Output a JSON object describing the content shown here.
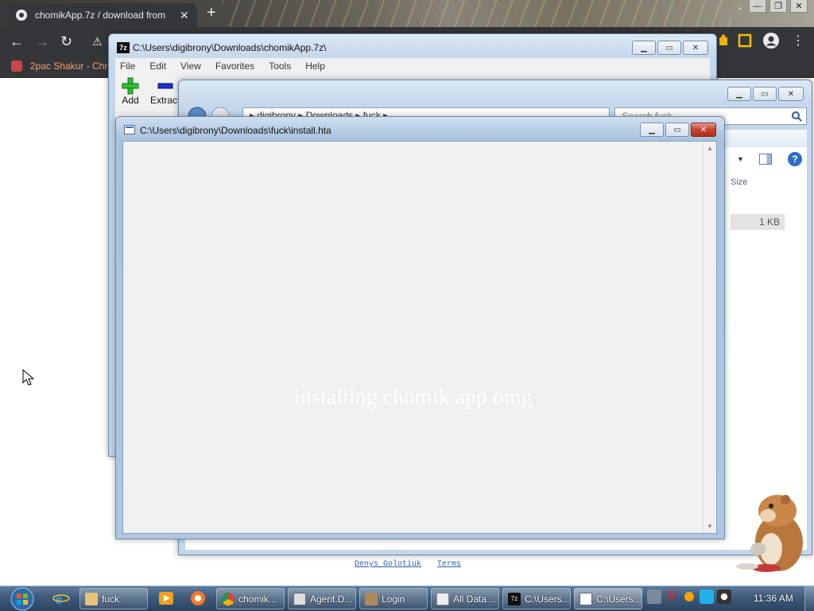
{
  "chrome": {
    "tab_title": "chomikApp.7z / download from",
    "tab_close": "✕",
    "new_tab": "+",
    "bookmark_label": "2pac Shakur - Chro",
    "back": "←",
    "forward": "→",
    "reload": "↻"
  },
  "sevenzip": {
    "title": "C:\\Users\\digibrony\\Downloads\\chomikApp.7z\\",
    "menu": [
      "File",
      "Edit",
      "View",
      "Favorites",
      "Tools",
      "Help"
    ],
    "tools": {
      "add": "Add",
      "extract": "Extract"
    }
  },
  "explorer": {
    "address": "▸ digibrony ▸ Downloads ▸ fuck ▸",
    "search_placeholder": "Search fuck",
    "size_header": "Size",
    "size_value": "1 KB",
    "help": "?"
  },
  "hta": {
    "title": "C:\\Users\\digibrony\\Downloads\\fuck\\install.hta",
    "message": "installing chomik app omg"
  },
  "footer": {
    "author_link": "Denys Golotiuk",
    "terms_link": "Terms"
  },
  "taskbar": {
    "items": [
      "fuck",
      "chomik...",
      "Agent.D...",
      "Login",
      "All Data ...",
      "C:\\Users...",
      "C:\\Users..."
    ],
    "clock": "11:36 AM"
  },
  "colors": {
    "chrome_dark": "#35363a",
    "taskbar_blue": "#3e5a7a",
    "link_blue": "#2a5db0"
  }
}
